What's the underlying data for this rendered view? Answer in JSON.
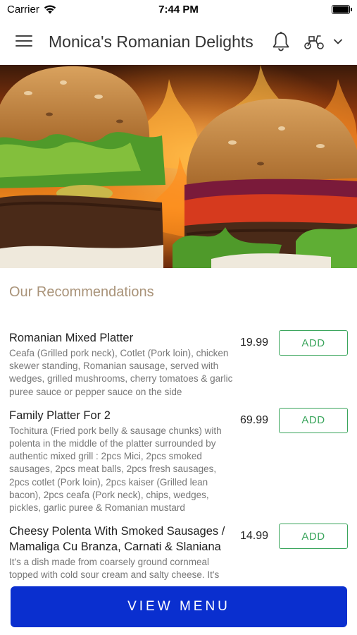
{
  "status_bar": {
    "carrier": "Carrier",
    "time": "7:44 PM"
  },
  "header": {
    "title": "Monica's Romanian Delights",
    "icons": [
      "menu-icon",
      "bell-icon",
      "scooter-icon",
      "chevron-down-icon"
    ]
  },
  "hero": {
    "image": "burgers-on-flames"
  },
  "recommendations": {
    "title": "Our Recommendations",
    "add_label": "ADD",
    "items": [
      {
        "name": "Romanian Mixed Platter",
        "description": "Ceafa (Grilled pork neck), Cotlet (Pork loin), chicken skewer standing, Romanian sausage, served with wedges, grilled mushrooms, cherry tomatoes & garlic puree sauce or pepper sauce on the side",
        "price": "19.99"
      },
      {
        "name": "Family Platter For 2",
        "description": "Tochitura (Fried pork belly & sausage chunks) with polenta in the middle of the platter surrounded by authentic mixed grill : 2pcs Mici, 2pcs smoked sausages, 2pcs meat balls, 2pcs fresh sausages, 2pcs cotlet (Pork loin), 2pcs kaiser (Grilled lean bacon), 2pcs ceafa (Pork neck), chips, wedges, pickles, garlic puree & Romanian mustard",
        "price": "69.99"
      },
      {
        "name": "Cheesy Polenta With Smoked Sausages / Mamaliga Cu Branza, Carnati & Slaniana",
        "description": "It's a dish made from coarsely ground cornmeal topped with cold sour cream and salty cheese. It's",
        "price": "14.99"
      }
    ]
  },
  "footer": {
    "view_menu_label": "VIEW MENU"
  },
  "colors": {
    "primary_button": "#0a2fcf",
    "add_button": "#3aa55c",
    "section_title": "#a99379"
  }
}
